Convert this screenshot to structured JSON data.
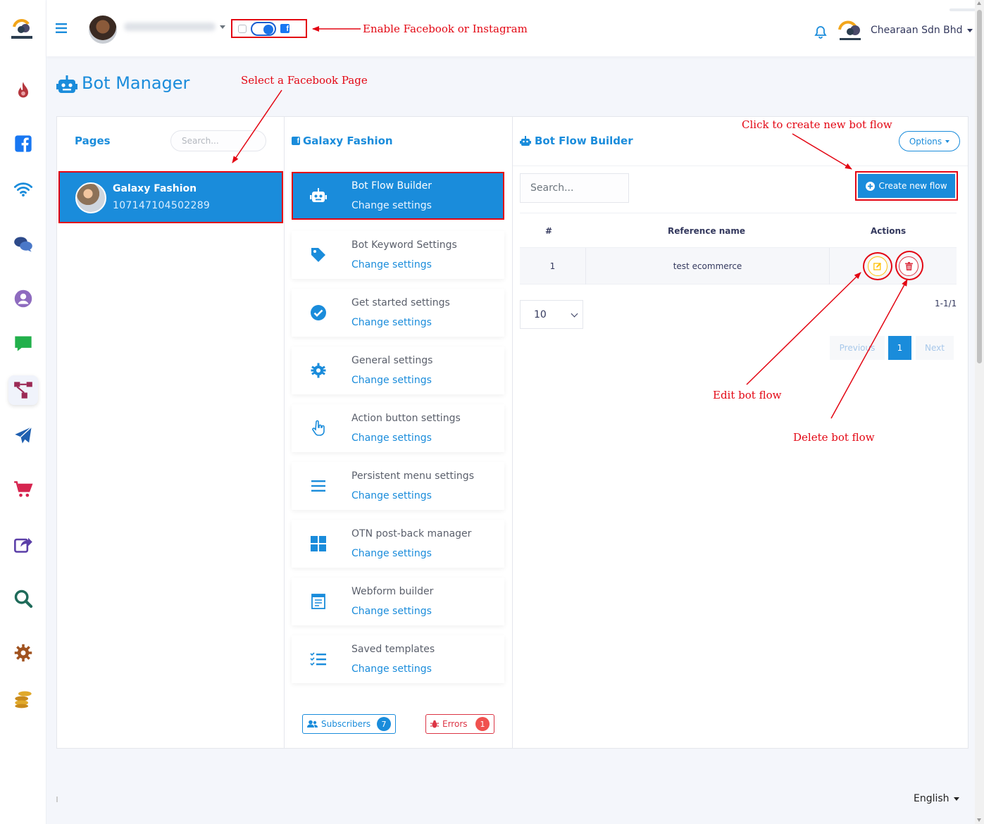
{
  "topbar": {
    "company_name": "Chearaan Sdn Bhd"
  },
  "page_header": {
    "title": "Bot Manager"
  },
  "pages_panel": {
    "title": "Pages",
    "search_placeholder": "Search...",
    "items": [
      {
        "name": "Galaxy Fashion",
        "id": "107147104502289"
      }
    ]
  },
  "settings_panel": {
    "title": "Galaxy Fashion",
    "items": [
      {
        "title": "Bot Flow Builder",
        "action": "Change settings",
        "icon": "robot-icon"
      },
      {
        "title": "Bot Keyword Settings",
        "action": "Change settings",
        "icon": "tag-icon"
      },
      {
        "title": "Get started settings",
        "action": "Change settings",
        "icon": "check-circle-icon"
      },
      {
        "title": "General settings",
        "action": "Change settings",
        "icon": "gear-icon"
      },
      {
        "title": "Action button settings",
        "action": "Change settings",
        "icon": "hand-pointer-icon"
      },
      {
        "title": "Persistent menu settings",
        "action": "Change settings",
        "icon": "menu-icon"
      },
      {
        "title": "OTN post-back manager",
        "action": "Change settings",
        "icon": "grid-icon"
      },
      {
        "title": "Webform builder",
        "action": "Change settings",
        "icon": "form-icon"
      },
      {
        "title": "Saved templates",
        "action": "Change settings",
        "icon": "list-check-icon"
      }
    ],
    "subscribers_label": "Subscribers",
    "subscribers_count": "7",
    "errors_label": "Errors",
    "errors_count": "1"
  },
  "flow_panel": {
    "title": "Bot Flow Builder",
    "options_label": "Options",
    "search_placeholder": "Search...",
    "create_label": "Create new flow",
    "table": {
      "headers": [
        "#",
        "Reference name",
        "Actions"
      ],
      "rows": [
        {
          "num": "1",
          "name": "test ecommerce"
        }
      ]
    },
    "page_size": "10",
    "range": "1-1/1",
    "pagination": {
      "prev": "Previous",
      "current": "1",
      "next": "Next"
    }
  },
  "annotations": {
    "enable_fb_ig": "Enable Facebook or Instagram",
    "select_page": "Select a Facebook Page",
    "create_flow": "Click to create new bot flow",
    "edit_flow": "Edit bot flow",
    "delete_flow": "Delete bot flow"
  },
  "footer": {
    "language": "English"
  },
  "colors": {
    "primary": "#1a8cdb",
    "annotation": "#e30613",
    "danger": "#dc3545",
    "warning": "#ffc107"
  },
  "sidebar_icons": [
    "flame-icon",
    "facebook-icon",
    "wifi-icon",
    "chat-bubbles-icon",
    "user-circle-icon",
    "message-icon",
    "flow-icon",
    "send-icon",
    "cart-icon",
    "share-icon",
    "search-icon",
    "gear-icon",
    "coins-icon"
  ]
}
